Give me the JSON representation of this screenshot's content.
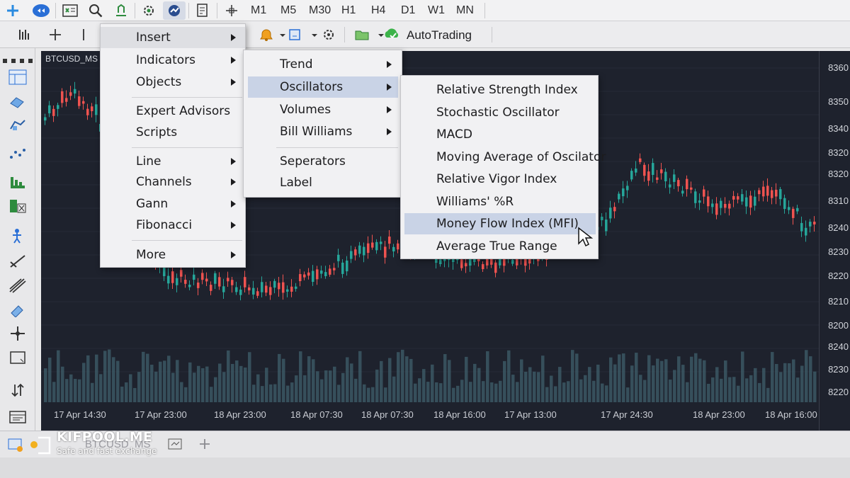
{
  "toolbar": {
    "timeframes": [
      "M1",
      "M5",
      "M30",
      "H1",
      "H4",
      "D1",
      "W1",
      "MN"
    ],
    "autotrading_label": "AutoTrading"
  },
  "chart": {
    "symbol": "BTCUSD_MS",
    "price_labels": [
      "8360",
      "8350",
      "8340",
      "8320",
      "8320",
      "8310",
      "8240",
      "8230",
      "8220",
      "8210",
      "8200",
      "8240",
      "8230",
      "8220"
    ],
    "time_labels": [
      "17 Apr 14:30",
      "17 Apr 23:00",
      "18 Apr 23:00",
      "18 Apr 07:30",
      "18 Apr 07:30",
      "18 Apr 16:00",
      "17 Apr 13:00",
      "17 Apr 24:30",
      "18 Apr 23:00",
      "18 Apr 16:00"
    ],
    "colors": {
      "background": "#1e222d",
      "bull": "#26a69a",
      "bear": "#ef5350",
      "volume": "#3f5f6b"
    }
  },
  "menu_main": {
    "items": [
      {
        "label": "Insert",
        "submenu": true
      },
      {
        "label": "Indicators",
        "submenu": true
      },
      {
        "label": "Objects",
        "submenu": true
      },
      {
        "label": "Expert Advisors",
        "submenu": false
      },
      {
        "label": "Scripts",
        "submenu": false
      },
      {
        "label": "Line",
        "submenu": true
      },
      {
        "label": "Channels",
        "submenu": true
      },
      {
        "label": "Gann",
        "submenu": true
      },
      {
        "label": "Fibonacci",
        "submenu": true
      },
      {
        "label": "More",
        "submenu": true
      }
    ]
  },
  "menu_indicators": {
    "items": [
      {
        "label": "Trend",
        "submenu": true
      },
      {
        "label": "Oscillators",
        "submenu": true,
        "highlighted": true
      },
      {
        "label": "Volumes",
        "submenu": true
      },
      {
        "label": "Bill Williams",
        "submenu": true
      },
      {
        "label": "Seperators",
        "submenu": false
      },
      {
        "label": "Label",
        "submenu": false
      }
    ]
  },
  "menu_oscillators": {
    "items": [
      {
        "label": "Relative Strength Index"
      },
      {
        "label": "Stochastic Oscillator"
      },
      {
        "label": "MACD"
      },
      {
        "label": "Moving Average of Oscilator"
      },
      {
        "label": "Relative Vigor Index"
      },
      {
        "label": "Williams' %R"
      },
      {
        "label": "Money Flow Index (MFI)",
        "highlighted": true
      },
      {
        "label": "Average True Range"
      }
    ]
  },
  "bottom": {
    "tab_label": "BTCUSD_MS",
    "logo_title": "KIFPOOL.ME",
    "logo_subtitle": "Safe and fast exchange"
  }
}
